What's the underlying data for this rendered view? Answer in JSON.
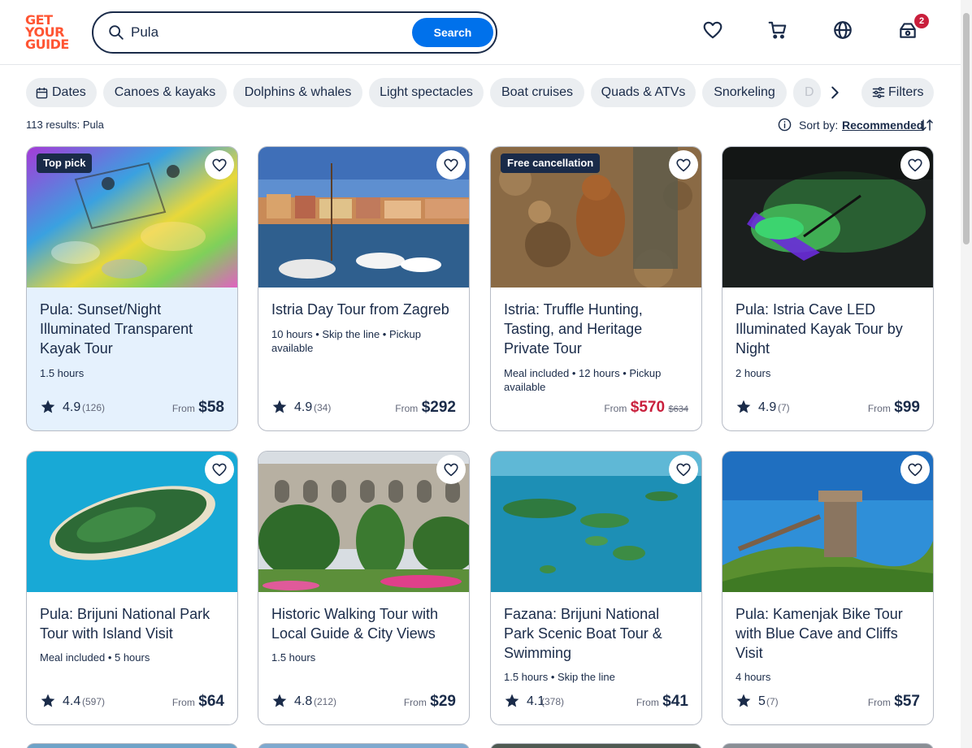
{
  "header": {
    "logo_lines": [
      "GET",
      "YOUR",
      "GUIDE"
    ],
    "search_value": "Pula",
    "search_button": "Search",
    "cart_badge": "2"
  },
  "chips": {
    "dates": "Dates",
    "items": [
      "Canoes & kayaks",
      "Dolphins & whales",
      "Light spectacles",
      "Boat cruises",
      "Quads & ATVs",
      "Snorkeling",
      "D"
    ],
    "filters": "Filters"
  },
  "results": {
    "count": "113 results: Pula",
    "sort_label": "Sort by:",
    "sort_value": "Recommended"
  },
  "cards": [
    {
      "tag": "Top pick",
      "title": "Pula: Sunset/Night Illuminated Transparent Kayak Tour",
      "meta": "1.5 hours",
      "rating": "4.9",
      "reviews": "(126)",
      "from": "From",
      "price": "$58",
      "old_price": ""
    },
    {
      "tag": "",
      "title": "Istria Day Tour from Zagreb",
      "meta": "10 hours • Skip the line • Pickup available",
      "rating": "4.9",
      "reviews": "(34)",
      "from": "From",
      "price": "$292",
      "old_price": ""
    },
    {
      "tag": "Free cancellation",
      "title": "Istria: Truffle Hunting, Tasting, and Heritage Private Tour",
      "meta": "Meal included • 12 hours • Pickup available",
      "rating": "",
      "reviews": "",
      "from": "From",
      "price": "$570",
      "old_price": "$634"
    },
    {
      "tag": "",
      "title": "Pula: Istria Cave LED Illuminated Kayak Tour by Night",
      "meta": "2 hours",
      "rating": "4.9",
      "reviews": "(7)",
      "from": "From",
      "price": "$99",
      "old_price": ""
    },
    {
      "tag": "",
      "title": "Pula: Brijuni National Park Tour with Island Visit",
      "meta": "Meal included • 5 hours",
      "rating": "4.4",
      "reviews": "(597)",
      "from": "From",
      "price": "$64",
      "old_price": ""
    },
    {
      "tag": "",
      "title": "Historic Walking Tour with Local Guide & City Views",
      "meta": "1.5 hours",
      "rating": "4.8",
      "reviews": "(212)",
      "from": "From",
      "price": "$29",
      "old_price": ""
    },
    {
      "tag": "",
      "title": "Fazana: Brijuni National Park Scenic Boat Tour & Swimming",
      "meta": "1.5 hours • Skip the line",
      "rating": "4.1",
      "reviews": "(378)",
      "from": "From",
      "price": "$41",
      "old_price": ""
    },
    {
      "tag": "",
      "title": "Pula: Kamenjak Bike Tour with Blue Cave and Cliffs Visit",
      "meta": "4 hours",
      "rating": "5",
      "reviews": "(7)",
      "from": "From",
      "price": "$57",
      "old_price": ""
    }
  ],
  "colors": {
    "brand": "#ff5533",
    "primary": "#0071eb",
    "text": "#1a2b49",
    "sale": "#c91f3c",
    "selected_card": "#e5f1fd"
  }
}
